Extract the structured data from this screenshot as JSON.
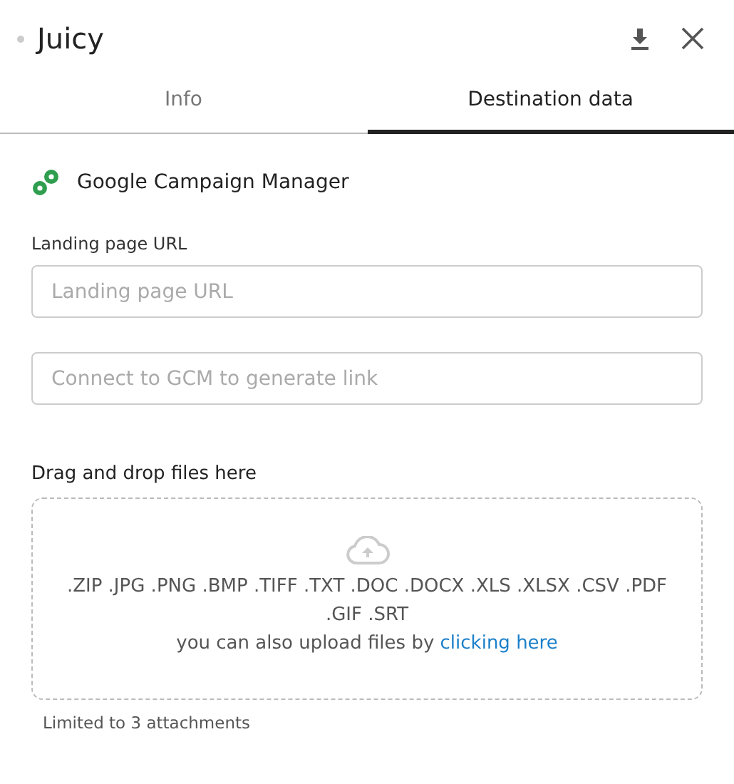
{
  "window": {
    "title": "Juicy"
  },
  "tabs": [
    {
      "label": "Info",
      "selected": false
    },
    {
      "label": "Destination data",
      "selected": true
    }
  ],
  "integration": {
    "name": "Google Campaign Manager"
  },
  "landing_url": {
    "label": "Landing page URL",
    "placeholder": "Landing page URL"
  },
  "generated_link": {
    "placeholder": "Connect to GCM to generate link"
  },
  "upload": {
    "title": "Drag and drop files here",
    "file_types": ".ZIP .JPG .PNG .BMP .TIFF .TXT .DOC .DOCX .XLS .XLSX .CSV .PDF .GIF .SRT",
    "hint": "you can also upload files by",
    "link": "clicking here",
    "limit": "Limited to 3 attachments"
  }
}
